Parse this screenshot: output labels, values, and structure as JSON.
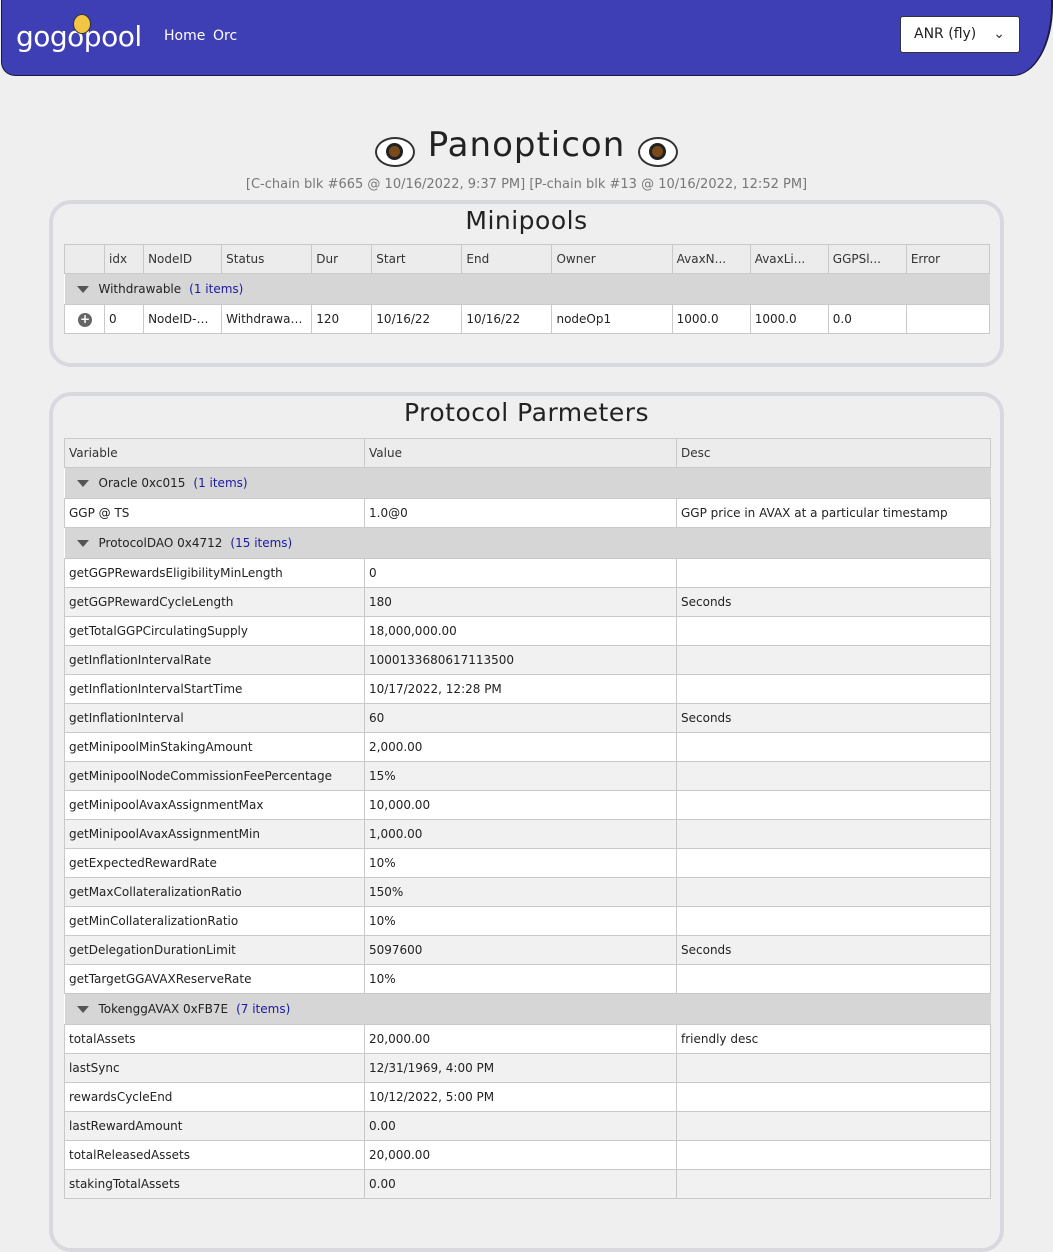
{
  "nav": {
    "logo": "gogopool",
    "links": [
      "Home",
      "Orc"
    ],
    "network": "ANR (fly)"
  },
  "header": {
    "title": "Panopticon",
    "subtitle": "[C-chain blk #665 @ 10/16/2022, 9:37 PM] [P-chain blk #13 @ 10/16/2022, 12:52 PM]"
  },
  "minipools": {
    "title": "Minipools",
    "columns": [
      "",
      "idx",
      "NodeID",
      "Status",
      "Dur",
      "Start",
      "End",
      "Owner",
      "AvaxN...",
      "AvaxLi...",
      "GGPSl...",
      "Error"
    ],
    "group": {
      "label": "Withdrawable",
      "count": "(1 items)"
    },
    "rows": [
      [
        "",
        "0",
        "NodeID-D...",
        "Withdrawable",
        "120",
        "10/16/22",
        "10/16/22",
        "nodeOp1",
        "1000.0",
        "1000.0",
        "0.0",
        ""
      ]
    ]
  },
  "params": {
    "title": "Protocol Parmeters",
    "columns": [
      "Variable",
      "Value",
      "Desc"
    ],
    "groups": [
      {
        "label": "Oracle 0xc015",
        "count": "(1 items)",
        "rows": [
          [
            "GGP @ TS",
            "1.0@0",
            "GGP price in AVAX at a particular timestamp"
          ]
        ]
      },
      {
        "label": "ProtocolDAO 0x4712",
        "count": "(15 items)",
        "rows": [
          [
            "getGGPRewardsEligibilityMinLength",
            "0",
            ""
          ],
          [
            "getGGPRewardCycleLength",
            "180",
            "Seconds"
          ],
          [
            "getTotalGGPCirculatingSupply",
            "18,000,000.00",
            ""
          ],
          [
            "getInflationIntervalRate",
            "1000133680617113500",
            ""
          ],
          [
            "getInflationIntervalStartTime",
            "10/17/2022, 12:28 PM",
            ""
          ],
          [
            "getInflationInterval",
            "60",
            "Seconds"
          ],
          [
            "getMinipoolMinStakingAmount",
            "2,000.00",
            ""
          ],
          [
            "getMinipoolNodeCommissionFeePercentage",
            "15%",
            ""
          ],
          [
            "getMinipoolAvaxAssignmentMax",
            "10,000.00",
            ""
          ],
          [
            "getMinipoolAvaxAssignmentMin",
            "1,000.00",
            ""
          ],
          [
            "getExpectedRewardRate",
            "10%",
            ""
          ],
          [
            "getMaxCollateralizationRatio",
            "150%",
            ""
          ],
          [
            "getMinCollateralizationRatio",
            "10%",
            ""
          ],
          [
            "getDelegationDurationLimit",
            "5097600",
            "Seconds"
          ],
          [
            "getTargetGGAVAXReserveRate",
            "10%",
            ""
          ]
        ]
      },
      {
        "label": "TokenggAVAX 0xFB7E",
        "count": "(7 items)",
        "rows": [
          [
            "totalAssets",
            "20,000.00",
            "friendly desc"
          ],
          [
            "lastSync",
            "12/31/1969, 4:00 PM",
            ""
          ],
          [
            "rewardsCycleEnd",
            "10/12/2022, 5:00 PM",
            ""
          ],
          [
            "lastRewardAmount",
            "0.00",
            ""
          ],
          [
            "totalReleasedAssets",
            "20,000.00",
            ""
          ],
          [
            "stakingTotalAssets",
            "0.00",
            ""
          ]
        ]
      }
    ]
  }
}
